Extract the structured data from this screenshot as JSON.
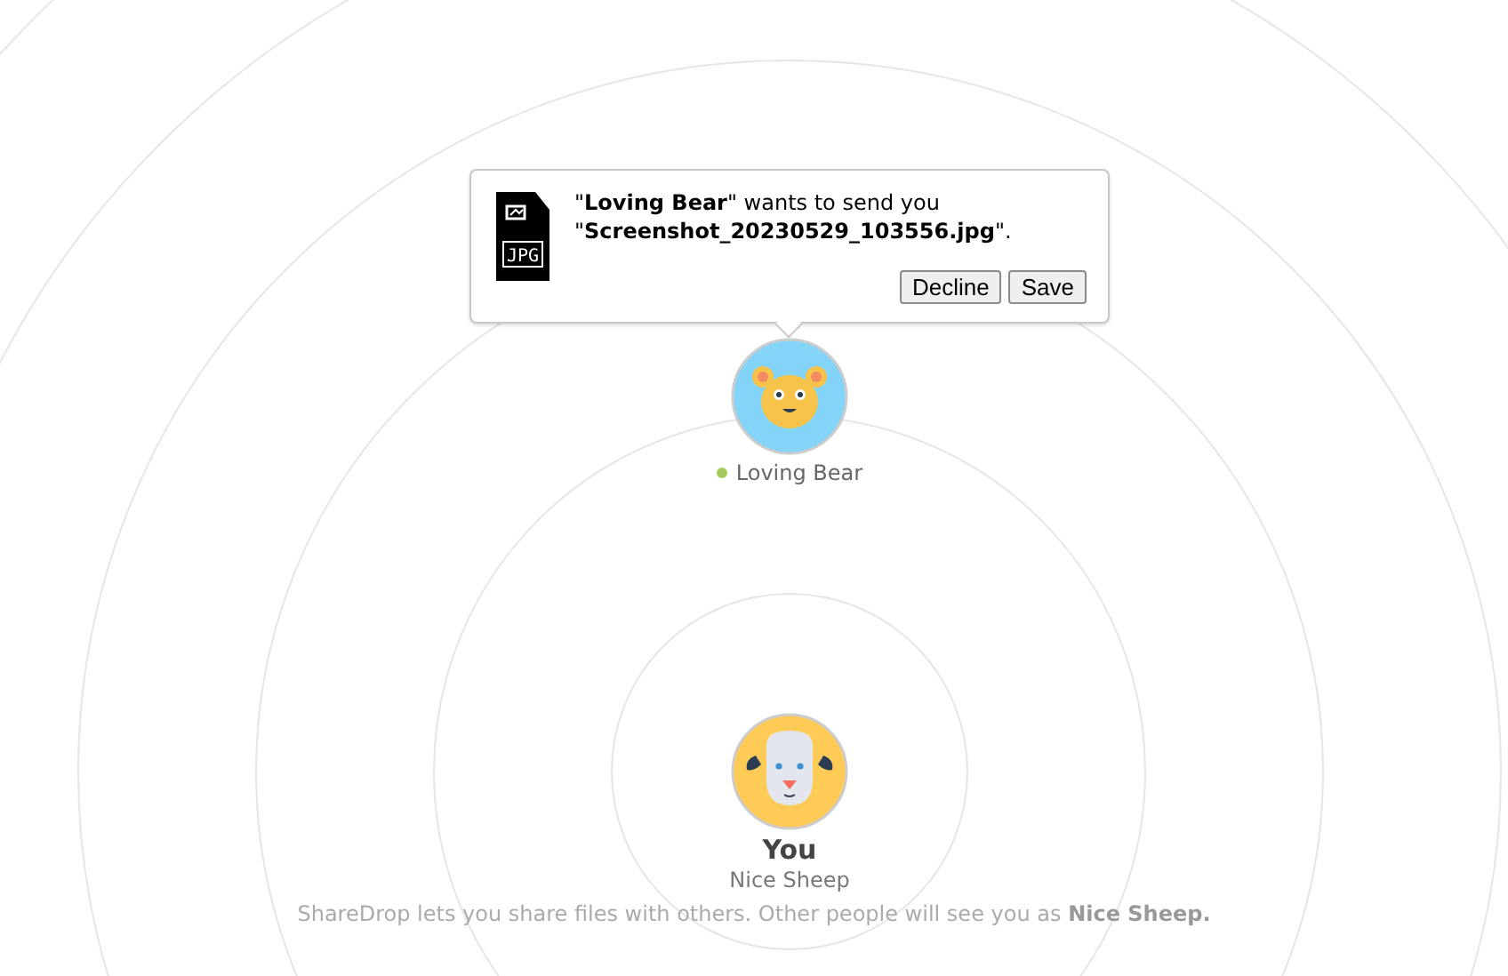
{
  "transfer_request": {
    "message": "\"**Loving Bear**\" wants to send you \"**Screenshot_20230529_103556.jpg**\".",
    "file_type": "JPG",
    "buttons": [
      {
        "label": "Decline"
      },
      {
        "label": "Save"
      }
    ]
  },
  "peer": {
    "name": "Loving Bear",
    "online": true
  },
  "you": {
    "title": "You",
    "name": "Nice Sheep"
  },
  "footer": "ShareDrop lets you share files with others. Other people will see you as **Nice Sheep.**"
}
